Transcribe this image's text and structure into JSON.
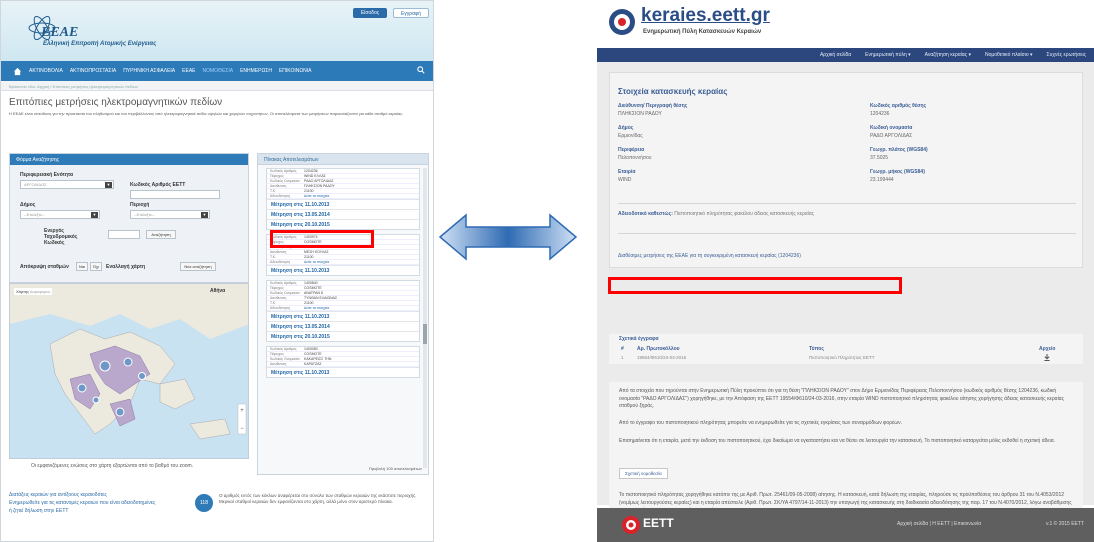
{
  "left": {
    "logo_title": "EEAE",
    "logo_subtitle": "Ελληνική Επιτροπή Ατομικής Ενέργειας",
    "top_buttons": [
      "Είσοδος",
      "Εγγραφή"
    ],
    "nav": [
      "ΑΚΤΙΝΟΒΟΛΙΑ",
      "ΑΚΤΙΝΟΠΡΟΣΤΑΣΙΑ",
      "ΠΥΡΗΝΙΚΗ ΑΣΦΑΛΕΙΑ",
      "ΕΕΑΕ",
      "ΝΟΜΟΘΕΣΙΑ",
      "ΕΝΗΜΕΡΩΣΗ",
      "ΕΠΙΚΟΙΝΩΝΙΑ"
    ],
    "breadcrumb": "Βρίσκεστε εδώ: Αρχική / Επιτόπιες μετρήσεις ηλεκτρομαγνητικών πεδίων",
    "page_title": "Επιτόπιες μετρήσεις ηλεκτρομαγνητικών πεδίων",
    "description": "Η ΕΕΑΕ είναι υπεύθυνη για την προστασία του πληθυσμού και του περιβάλλοντος από ηλεκτρομαγνητικά πεδία υψηλών και χαμηλών συχνοτήτων. Οι αποτελέσματα των μετρήσεων παρουσιάζονται για κάθε σταθμό κεραίας.",
    "form": {
      "header": "Φόρμα Αναζήτησης",
      "region_label": "Περιφερειακή Ενότητα",
      "region_value": "ΑΡΓΟΛΙΔΟΣ",
      "eett_label": "Κωδικός Αριθμός ΕΕΤΤ",
      "municipality_label": "Δήμος",
      "area_label": "Περιοχή",
      "select_placeholder": "--Επιλέξτε--",
      "postal_label": "Ενεργός Ταχυδρομικός Κωδικός",
      "search_button": "Αναζήτηση",
      "display_label": "Απόκρυψη σταθμών",
      "yes": "Ναι",
      "no": "Όχι",
      "sort_label": "Εναλλαγή χάρτη",
      "sort_button": "Νέα αναζήτηση"
    },
    "map": {
      "tab_map": "Χάρτης",
      "tab_satellite": "Δορυφόρος",
      "label": "Αθήνα",
      "caption": "Οι εμφανιζόμενες ενώσεις στο χάρτη εξαρτώνται από το βαθμό του zoom."
    },
    "results": {
      "header": "Πίνακας Αποτελεσμάτων",
      "row_keys": [
        "Κωδικός Αριθμός",
        "Πάροχος",
        "Κωδικός Ονομασία",
        "Διεύθυνση",
        "Τ.Κ.",
        "Αδειοδότηση"
      ],
      "cards": [
        {
          "values": [
            "1204236",
            "WIND ΕΛΛΑΣ",
            "ΡΑΔΟ ΑΡΓΟΛΙΔΑΣ",
            "ΠΛΗΚΣΙΟΝ ΡΑΔΟΥ",
            "21100",
            "Δείτε τα στοιχεία"
          ],
          "links": [
            "Μέτρηση στις 11.10.2013",
            "Μέτρηση στις 13.05.2014",
            "Μέτρηση στις 20.10.2015"
          ]
        },
        {
          "values": [
            "1400974",
            "COSMOTE",
            "ΚΟΥΛΑΙ 1 3",
            "ΜΕΣΗ ΚΟΥΛΑΣ",
            "21100",
            "Δείτε τα στοιχεία"
          ],
          "links": [
            "Μέτρηση στις 11.10.2013"
          ]
        },
        {
          "values": [
            "1400840",
            "COSMOTE",
            "ΑΝΑΤΡΑΝ 8",
            "ΤΥΝΘΑΝ ΕΛΑΙΩΝΑΣ",
            "21100",
            "Δείτε τα στοιχεία"
          ],
          "links": [
            "Μέτρηση στις 11.10.2013",
            "Μέτρηση στις 13.05.2014",
            "Μέτρηση στις 20.10.2015"
          ]
        },
        {
          "values": [
            "1400083",
            "COSMOTE",
            "ΚΑΚΑΡΕΙΣΣ ΤΗΝ",
            "ΚΑΡΑΤΖΑΣ",
            "21100",
            "Δείτε τα στοιχεία"
          ],
          "links": [
            "Μέτρηση στις 11.10.2013"
          ]
        }
      ],
      "footer": "Προβολή 100 αποτελεσμάτων"
    },
    "bottom": {
      "links": [
        "Διατάξεις κεραιών για αντίξοους κεραιοδότες",
        "Ενημερωθείτε για τις κατανομές κεραιών που είναι αδειοδοτημένες",
        "ή ζητεί δήλωση στην ΕΕΤΤ"
      ],
      "count": "118",
      "note": "Ο αριθμός εντός των κύκλων αναφέρεται στο σύνολο των σταθμών κεραιών της εκάστοτε περιοχής. Μερικοί σταθμοί κεραιών δεν εμφανίζονται στο χάρτη, αλλά μόνο στον αριστερό πίνακα."
    }
  },
  "right": {
    "logo_title": "keraies.eett.gr",
    "logo_subtitle": "Ενημερωτική Πύλη Κατασκευών Κεραιών",
    "nav": [
      "Αρχική σελίδα",
      "Ενημερωτική πύλη ▾",
      "Αναζήτηση κεραίας ▾",
      "Νομοθετικό πλαίσιο ▾",
      "Συχνές ερωτήσεις"
    ],
    "card_title": "Στοιχεία κατασκευής κεραίας",
    "fields_left": [
      {
        "label": "Διεύθυνση/ Περιγραφή θέσης",
        "value": "ΠΛΗΚΣΙΟΝ ΡΑΔΟΥ"
      },
      {
        "label": "Δήμος",
        "value": "Ερμιονίδας"
      },
      {
        "label": "Περιφέρεια",
        "value": "Πελοποννήσου"
      },
      {
        "label": "Εταιρία",
        "value": "WIND"
      }
    ],
    "fields_right": [
      {
        "label": "Κωδικός αριθμός θέσης",
        "value": "1204236"
      },
      {
        "label": "Κωδική ονομασία",
        "value": "ΡΑΔΟ ΑΡΓΟΛΙΔΑΣ"
      },
      {
        "label": "Γεωγρ. πλάτος (WGS84)",
        "value": "37.5025"
      },
      {
        "label": "Γεωγρ. μήκος (WGS84)",
        "value": "23.199444"
      }
    ],
    "status_label": "Αδειοδοτικό καθεστώς:",
    "status_value": "Πιστοποιητικό πληρότητας φακέλου άδειας κατασκευής κεραίας",
    "link": "Διαθέσιμες μετρήσεις της ΕΕΑΕ για τη συγκεκριμένη κατασκευή κεραίας (1204236)",
    "docs": {
      "caption": "Σχετικά έγγραφα",
      "columns": [
        "#",
        "Αρ. Πρωτοκόλλου",
        "Τύπος",
        "Αρχείο"
      ],
      "row": [
        "1",
        "19554/Φ610/24-03-2016",
        "Πιστοποιητικό Πληρότητας ΕΕΤΤ",
        ""
      ]
    },
    "text": [
      "Από τα στοιχεία που τηρούνται στην Ενημερωτική Πύλη προκύπτει ότι για τη θέση \"ΠΛΗΚΣΙΟΝ ΡΑΔΟΥ\" στον Δήμο Ερμιονίδας Περιφέρειας Πελοποννήσου (κωδικός αριθμός θέσης 1204236, κωδική ονομασία \"ΡΑΔΟ ΑΡΓΟΛΙΔΑΣ\") χορηγήθηκε, με την Απόφαση της ΕΕΤΤ 19554/Φ610/24-03-2016, στην εταιρία WIND πιστοποιητικό πληρότητας φακέλου αίτησης χορήγησης άδειας κατασκευής κεραίας σταθμού ξηράς.",
      "Από το έγγραφο του πιστοποιητικού πληρότητας μπορείτε να ενημερωθείτε για τις σχετικές εγκρίσεις των συναρμόδιων φορέων.",
      "Επισημαίνεται ότι η εταιρία, μετά την έκδοση του πιστοποιητικού, έχει δικαίωμα να εγκαταστήσει και να θέσει σε λειτουργία την κατασκευή. Το πιστοποιητικό καταργείται μόλις εκδοθεί η σχετική άδεια.",
      "Το πιστοποιητικό πληρότητας χορηγήθηκε κατόπιν της με Αριθ. Πρωτ. 25461/09-05-2008) αίτησης. Η κατασκευή, κατά δήλωση της εταιρίας, πληρούσε τις προϋποθέσεις του άρθρου 31 του Ν.4053/2012 (νομίμως λειτουργούσες κεραίες) και η εταιρία απέστειλε (Αριθ. Πρωτ. ΣΚ/ΥΑ 4797/14-11-2013) την υπαγωγή της κατασκευής στη διαδικασία αδειοδότησης της παρ. 17 του Ν.4070/2012, λόγω αναβάθμισης των παρεχόμενων προς το κοινό υπηρεσιών."
    ],
    "button_law": "Σχετική νομοθεσία",
    "footer_logo": "EETT",
    "footer_links": "Αρχική σελίδα | Η ΕΕΤΤ | Επικοινωνία",
    "footer_version": "v.1 © 2015 ΕΕΤΤ"
  },
  "colors": {
    "left_nav": "#2d7ab8",
    "right_nav": "#2b477e",
    "highlight": "#ff0000",
    "arrow": "#2f6bb3"
  }
}
